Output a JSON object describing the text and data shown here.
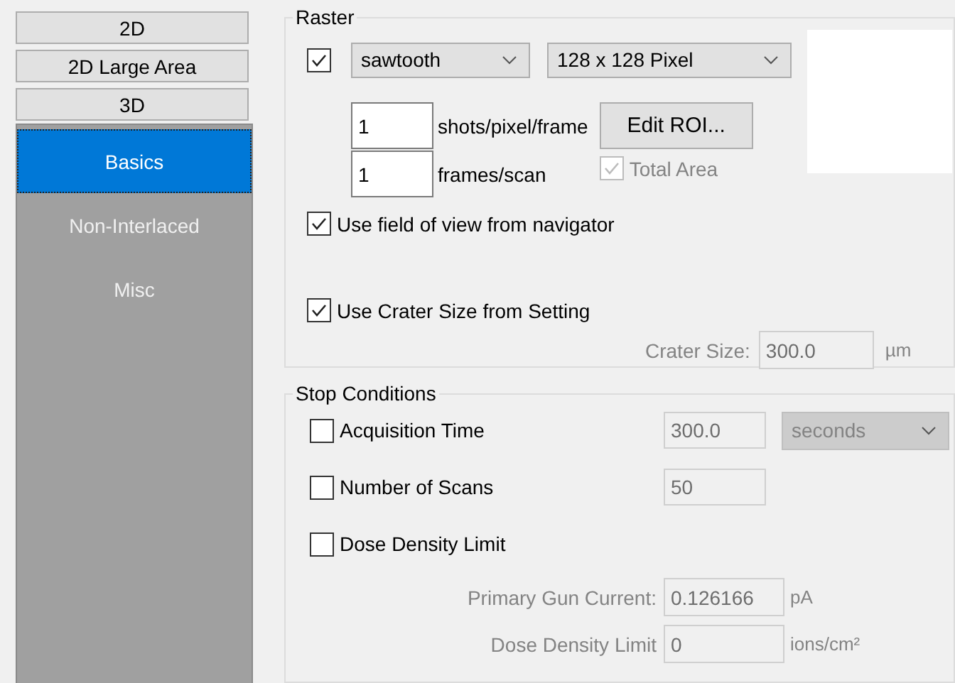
{
  "mode_buttons": [
    {
      "label": "2D"
    },
    {
      "label": "2D Large Area"
    },
    {
      "label": "3D"
    }
  ],
  "side_tabs": [
    {
      "label": "Basics",
      "selected": true
    },
    {
      "label": "Non-Interlaced",
      "selected": false
    },
    {
      "label": "Misc",
      "selected": false
    }
  ],
  "raster": {
    "title": "Raster",
    "enabled": true,
    "scan_pattern": "sawtooth",
    "resolution": "128 x 128 Pixel",
    "shots_per_pixel": {
      "value": "1",
      "label": "shots/pixel/frame"
    },
    "frames_per_scan": {
      "value": "1",
      "label": "frames/scan"
    },
    "edit_roi_button": "Edit ROI...",
    "total_area": {
      "label": "Total Area",
      "checked": true,
      "disabled": true
    },
    "options": [
      {
        "label": "Use field of view from navigator",
        "checked": true
      },
      {
        "label": "Use Crater Size from Setting",
        "checked": true
      }
    ],
    "crater_size": {
      "label": "Crater Size:",
      "value": "300.0",
      "unit": "µm",
      "disabled": true
    }
  },
  "stop_conditions": {
    "title": "Stop Conditions",
    "conditions": [
      {
        "label": "Acquisition Time",
        "checked": false,
        "value": "300.0",
        "unit_select": "seconds",
        "disabled": true
      },
      {
        "label": "Number of Scans",
        "checked": false,
        "value": "50",
        "disabled": true
      },
      {
        "label": "Dose Density Limit",
        "checked": false
      }
    ],
    "dose_fields": [
      {
        "label": "Primary Gun Current:",
        "value": "0.126166",
        "unit": "pA",
        "disabled": true
      },
      {
        "label": "Dose Density Limit",
        "value": "0",
        "unit": "ions/cm²",
        "disabled": true
      }
    ]
  }
}
